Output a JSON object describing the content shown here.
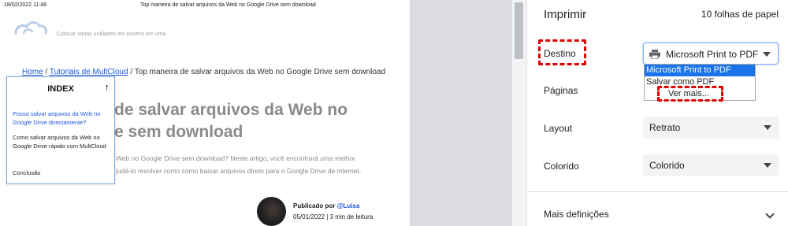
{
  "preview": {
    "header_date": "18/02/2022 11:48",
    "header_title": "Top maneira de salvar arquivos da Web no Google Drive sem download",
    "slogan": "Colocar varias unidades em nuvens em uma",
    "breadcrumb": {
      "home": "Home",
      "sep": "/",
      "category": "Tutoriais de MultCloud",
      "current": "Top maneira de salvar arquivos da Web no Google Drive sem download"
    },
    "title_line1": "de salvar arquivos da Web no",
    "title_line2": "e sem download",
    "intro_line1": "Web no Google Drive sem download? Neste artigo, você encontrará uma melhor",
    "intro_line2": "judá-lo resolver como como baixar arquivos direto para o Google Drive de internet.",
    "index": {
      "title": "INDEX",
      "arrow": "↑",
      "items": [
        "Posso salvar arquivos da Web no Google Drive directamente?",
        "Como salvar arquivos da Web no Google Drive rápido com MultCloud",
        "Conclusão"
      ]
    },
    "author": {
      "published_by": "Publicado por",
      "name": "@Luisa",
      "meta": "05/01/2022 | 3 min de leitura"
    }
  },
  "settings": {
    "title": "Imprimir",
    "sheets": "10 folhas de papel",
    "destination": {
      "label": "Destino",
      "value": "Microsoft Print to PDF",
      "icon": "printer-icon",
      "options": [
        "Microsoft Print to PDF",
        "Salvar como PDF",
        "Ver mais..."
      ],
      "selected_index": 0
    },
    "pages": {
      "label": "Páginas"
    },
    "layout": {
      "label": "Layout",
      "value": "Retrato"
    },
    "color": {
      "label": "Colorido",
      "value": "Colorido"
    },
    "more": {
      "label": "Mais definições"
    }
  },
  "colors": {
    "highlight": "#e00000",
    "selected_option": "#1a73e8",
    "link": "#1a56db"
  }
}
